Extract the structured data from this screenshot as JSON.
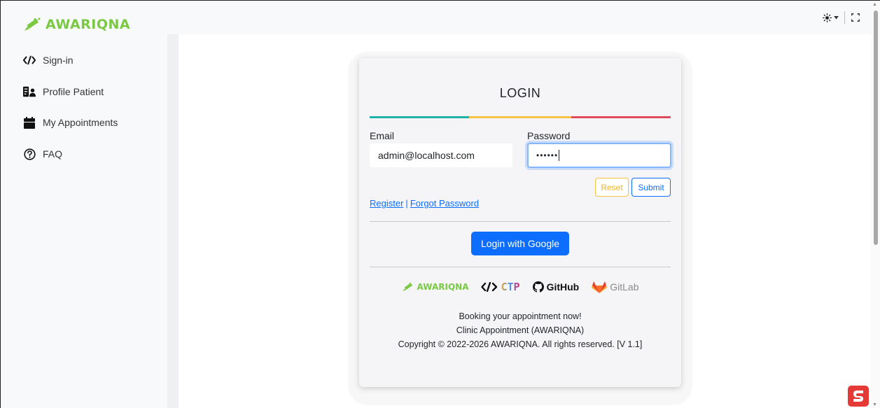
{
  "brand": {
    "name": "AWARIQNA",
    "color": "#7ac943"
  },
  "topbar": {
    "theme_icon": "sun-icon",
    "fullscreen_icon": "fullscreen-icon"
  },
  "sidebar": {
    "items": [
      {
        "label": "Sign-in",
        "icon": "code-icon"
      },
      {
        "label": "Profile Patient",
        "icon": "patient-icon"
      },
      {
        "label": "My Appointments",
        "icon": "calendar-icon"
      },
      {
        "label": "FAQ",
        "icon": "question-circle-icon"
      }
    ]
  },
  "login": {
    "title": "LOGIN",
    "email_label": "Email",
    "email_value": "admin@localhost.com",
    "password_label": "Password",
    "password_value": "••••••",
    "reset_label": "Reset",
    "submit_label": "Submit",
    "register_link": "Register",
    "link_separator": "|",
    "forgot_link": "Forgot Password",
    "google_label": "Login with Google"
  },
  "logos": {
    "awariqna": "AWARIQNA",
    "ctp": "CTP",
    "github": "GitHub",
    "gitlab": "GitLab"
  },
  "footer": {
    "line1": "Booking your appointment now!",
    "line2": "Clinic Appointment (AWARIQNA)",
    "line3": "Copyright © 2022-2026 AWARIQNA. All rights reserved. [V 1.1]"
  },
  "colors": {
    "primary": "#0d6efd",
    "warning": "#f5c242",
    "teal": "#20b2aa",
    "danger": "#e04a5a"
  }
}
